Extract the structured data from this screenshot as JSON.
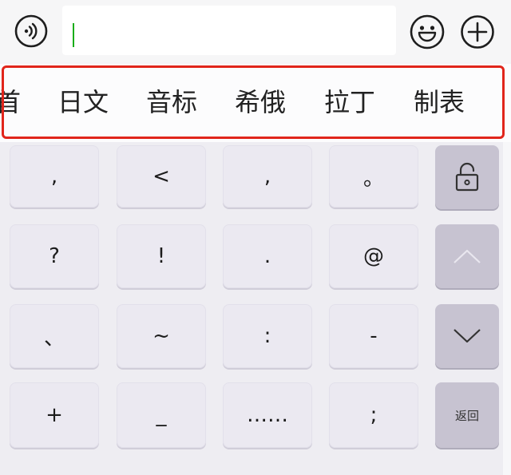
{
  "input": {
    "value": ""
  },
  "icons": {
    "voice": "voice-input-icon",
    "emoji": "emoji-icon",
    "plus": "plus-circle-icon",
    "lock": "lock-open-icon",
    "up": "chevron-up-icon",
    "down": "chevron-down-icon"
  },
  "categories": [
    {
      "label": "首"
    },
    {
      "label": "日文"
    },
    {
      "label": "音标"
    },
    {
      "label": "希俄"
    },
    {
      "label": "拉丁"
    },
    {
      "label": "制表"
    }
  ],
  "keys": {
    "row1": [
      {
        "label": ","
      },
      {
        "label": "<"
      },
      {
        "label": ","
      },
      {
        "label": "。"
      }
    ],
    "row2": [
      {
        "label": "?"
      },
      {
        "label": "!"
      },
      {
        "label": "."
      },
      {
        "label": "@"
      }
    ],
    "row3": [
      {
        "label": "、"
      },
      {
        "label": "~"
      },
      {
        "label": ":"
      },
      {
        "label": "-"
      }
    ],
    "row4": [
      {
        "label": "+"
      },
      {
        "label": "_"
      },
      {
        "label": "……"
      },
      {
        "label": ";"
      }
    ]
  },
  "func_keys": {
    "back_label": "返回"
  },
  "colors": {
    "caret": "#1aad19",
    "highlight_frame": "#e1251b",
    "key_bg": "#ebe9f1",
    "func_key_bg": "#c7c3d1"
  }
}
